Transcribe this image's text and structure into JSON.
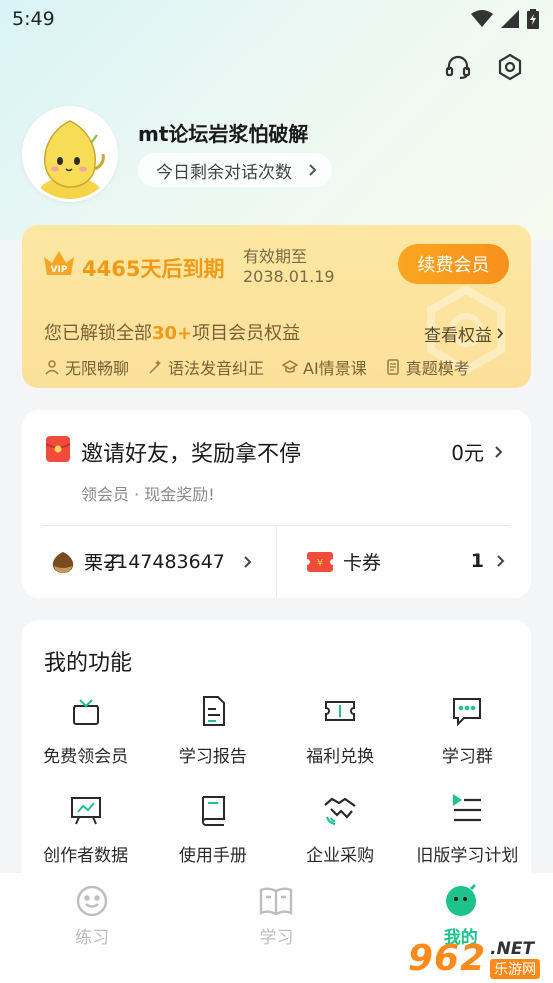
{
  "status_bar": {
    "time": "5:49"
  },
  "colors": {
    "accent_green": "#1ec28b",
    "vip_orange": "#f29a16",
    "vip_bg": "#fde7a2"
  },
  "header": {
    "icons": [
      "headset-icon",
      "settings-icon"
    ]
  },
  "profile": {
    "username": "mt论坛岩浆怕破解",
    "chat_count_label": "今日剩余对话次数"
  },
  "vip": {
    "crown_badge": "VIP",
    "days_left": "4465天后到期",
    "valid_label": "有效期至",
    "valid_date": "2038.01.19",
    "renew_label": "续费会员",
    "unlock_prefix": "您已解锁全部",
    "unlock_count": "30+",
    "unlock_suffix": "项目会员权益",
    "view_benefits": "查看权益",
    "benefits": [
      "无限畅聊",
      "语法发音纠正",
      "AI情景课",
      "真题模考"
    ]
  },
  "invite": {
    "title": "邀请好友，奖励拿不停",
    "amount": "0元",
    "subtitle": "领会员 · 现金奖励!",
    "chestnut_label": "栗子",
    "chestnut_value": "2147483647",
    "coupon_label": "卡券",
    "coupon_count": "1"
  },
  "functions": {
    "title": "我的功能",
    "items": [
      {
        "label": "免费领会员",
        "icon": "gift-icon"
      },
      {
        "label": "学习报告",
        "icon": "report-icon"
      },
      {
        "label": "福利兑换",
        "icon": "ticket-icon"
      },
      {
        "label": "学习群",
        "icon": "chat-group-icon"
      },
      {
        "label": "创作者数据",
        "icon": "chart-board-icon"
      },
      {
        "label": "使用手册",
        "icon": "book-icon"
      },
      {
        "label": "企业采购",
        "icon": "handshake-icon"
      },
      {
        "label": "旧版学习计划",
        "icon": "plan-list-icon"
      }
    ]
  },
  "bottom_nav": {
    "items": [
      {
        "label": "练习",
        "active": false
      },
      {
        "label": "学习",
        "active": false
      },
      {
        "label": "我的",
        "active": true
      }
    ]
  },
  "watermark": {
    "number": "962",
    "suffix": ".NET",
    "site": "乐游网"
  }
}
